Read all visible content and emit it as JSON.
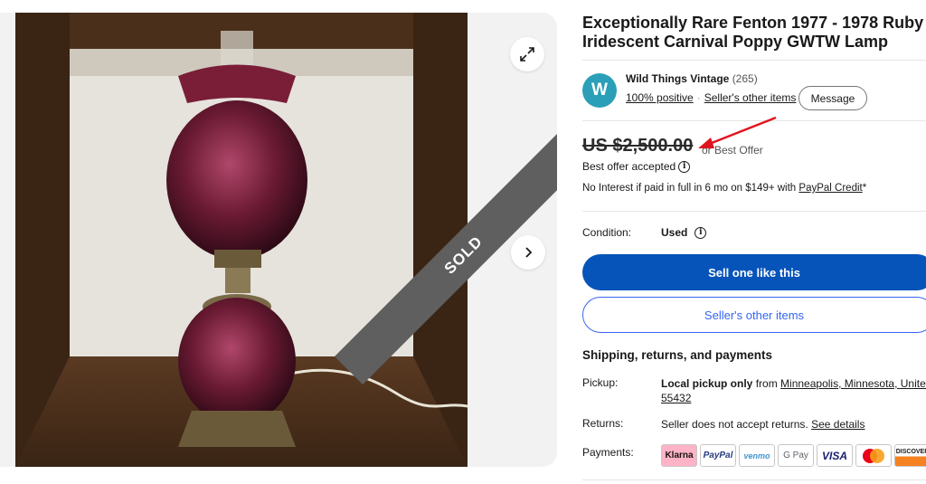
{
  "gallery": {
    "sold_label": "SOLD",
    "expand_icon": "expand-icon",
    "next_icon": "chevron-right-icon"
  },
  "listing": {
    "title": "Exceptionally Rare Fenton 1977 - 1978 Ruby Iridescent Carnival Poppy GWTW Lamp"
  },
  "seller": {
    "avatar_letter": "W",
    "avatar_color": "#2c9fb8",
    "name": "Wild Things Vintage",
    "feedback_count": "(265)",
    "positive": "100% positive",
    "other_items": "Seller's other items",
    "message_button": "Message"
  },
  "price": {
    "amount": "US $2,500.00",
    "or_best_offer": "or Best Offer",
    "best_offer_status": "Best offer accepted",
    "paypal_text": "No Interest if paid in full in 6 mo on $149+ with ",
    "paypal_link": "PayPal Credit",
    "paypal_suffix": "*"
  },
  "condition": {
    "label": "Condition:",
    "value": "Used"
  },
  "actions": {
    "sell_one": "Sell one like this",
    "seller_other_items": "Seller's other items"
  },
  "shipping": {
    "heading": "Shipping, returns, and payments",
    "pickup_label": "Pickup:",
    "pickup_bold": "Local pickup only",
    "pickup_from": " from ",
    "pickup_location": "Minneapolis, Minnesota, United",
    "pickup_zip": "55432",
    "returns_label": "Returns:",
    "returns_text": "Seller does not accept returns. ",
    "returns_link": "See details",
    "payments_label": "Payments:",
    "payment_methods": [
      "Klarna",
      "PayPal",
      "venmo",
      "G Pay",
      "VISA",
      "Mastercard",
      "DISCOVER"
    ]
  },
  "colors": {
    "primary_button": "#0654ba",
    "secondary_border": "#3665f3",
    "annotation_arrow": "#e0141e"
  }
}
